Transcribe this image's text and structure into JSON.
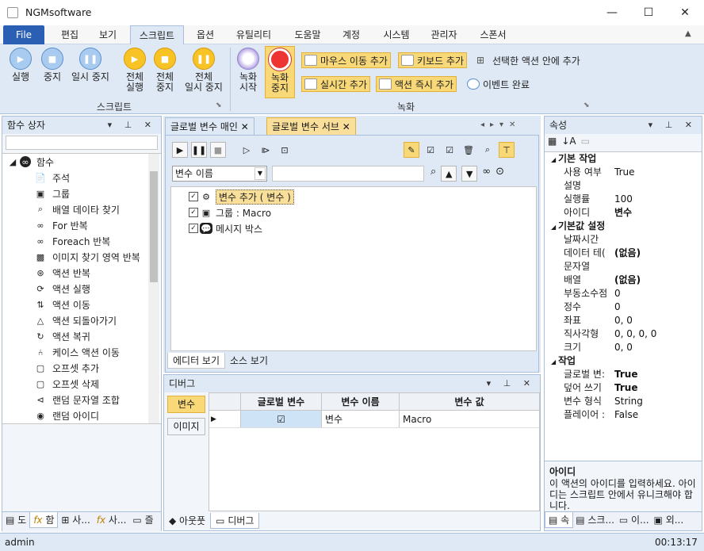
{
  "app": {
    "title": "NGMsoftware"
  },
  "window_controls": {
    "minimize": "—",
    "maximize": "☐",
    "close": "✕"
  },
  "ribbon_tabs": [
    "File",
    "편집",
    "보기",
    "스크립트",
    "옵션",
    "유틸리티",
    "도움말",
    "계정",
    "시스템",
    "관리자",
    "스폰서"
  ],
  "ribbon": {
    "script_group": {
      "label": "스크립트",
      "buttons": [
        [
          "실행"
        ],
        [
          "중지"
        ],
        [
          "일시 중지"
        ],
        [
          "전체",
          "실행"
        ],
        [
          "전체",
          "중지"
        ],
        [
          "전체",
          "일시 중지"
        ]
      ]
    },
    "record_group": {
      "label": "녹화",
      "record_start": [
        "녹화",
        "시작"
      ],
      "record_stop": [
        "녹화",
        "중지"
      ],
      "small": [
        "마우스 이동 추가",
        "키보드 추가",
        "선택한 액션 안에 추가",
        "실시간 추가",
        "액션 즉시 추가",
        "이벤트 완료"
      ]
    }
  },
  "function_box": {
    "title": "함수 상자",
    "root": "함수",
    "items": [
      "주석",
      "그룹",
      "배열 데이타 찾기",
      "For 반복",
      "Foreach 반복",
      "이미지 찾기 영역 반복",
      "액션 반복",
      "액션 실행",
      "액션 이동",
      "액션 되돌아가기",
      "액션 복귀",
      "케이스 액션 이동",
      "오프셋 추가",
      "오프셋 삭제",
      "랜덤 문자열 조합",
      "랜덤 아이디"
    ],
    "bottom_tabs": [
      "도",
      "함",
      "사...",
      "사...",
      "즐"
    ]
  },
  "documents": {
    "tabs": [
      "글로벌 변수 매인",
      "글로벌 변수 서브"
    ],
    "var_select": "변수 이름",
    "tree": [
      "변수 추가 ( 변수 )",
      "그룹 : Macro",
      "메시지 박스"
    ],
    "view_tabs": [
      "에디터 보기",
      "소스 보기"
    ]
  },
  "debug": {
    "title": "디버그",
    "side_buttons": [
      "변수",
      "이미지"
    ],
    "columns": [
      "글로벌 변수",
      "변수 이름",
      "변수 값"
    ],
    "row": {
      "name": "변수",
      "value": "Macro"
    },
    "bottom_tabs": [
      "아웃풋",
      "디버그"
    ]
  },
  "properties": {
    "title": "속성",
    "categories": [
      {
        "name": "기본 작업",
        "rows": [
          [
            "사용 여부",
            "True"
          ],
          [
            "설명",
            ""
          ],
          [
            "실행률",
            "100"
          ],
          [
            "아이디",
            "변수"
          ]
        ]
      },
      {
        "name": "기본값 설정",
        "rows": [
          [
            "날짜시간",
            ""
          ],
          [
            "데이터 테(",
            "(없음)"
          ],
          [
            "문자열",
            ""
          ],
          [
            "배열",
            "(없음)"
          ],
          [
            "부동소수점",
            "0"
          ],
          [
            "정수",
            "0"
          ],
          [
            "좌표",
            "0, 0"
          ],
          [
            "직사각형",
            "0, 0, 0, 0"
          ],
          [
            "크기",
            "0, 0"
          ]
        ]
      },
      {
        "name": "작업",
        "rows": [
          [
            "글로벌 변:",
            "True"
          ],
          [
            "덮어 쓰기",
            "True"
          ],
          [
            "변수 형식",
            "String"
          ],
          [
            "플레이어 :",
            "False"
          ]
        ]
      }
    ],
    "desc_title": "아이디",
    "desc_text": "이 액션의 아이디를 입력하세요. 아이디는 스크립트 안에서 유니크해야 합니다.",
    "bottom_tabs": [
      "속",
      "스크...",
      "이...",
      "외..."
    ]
  },
  "status": {
    "user": "admin",
    "time": "00:13:17"
  }
}
